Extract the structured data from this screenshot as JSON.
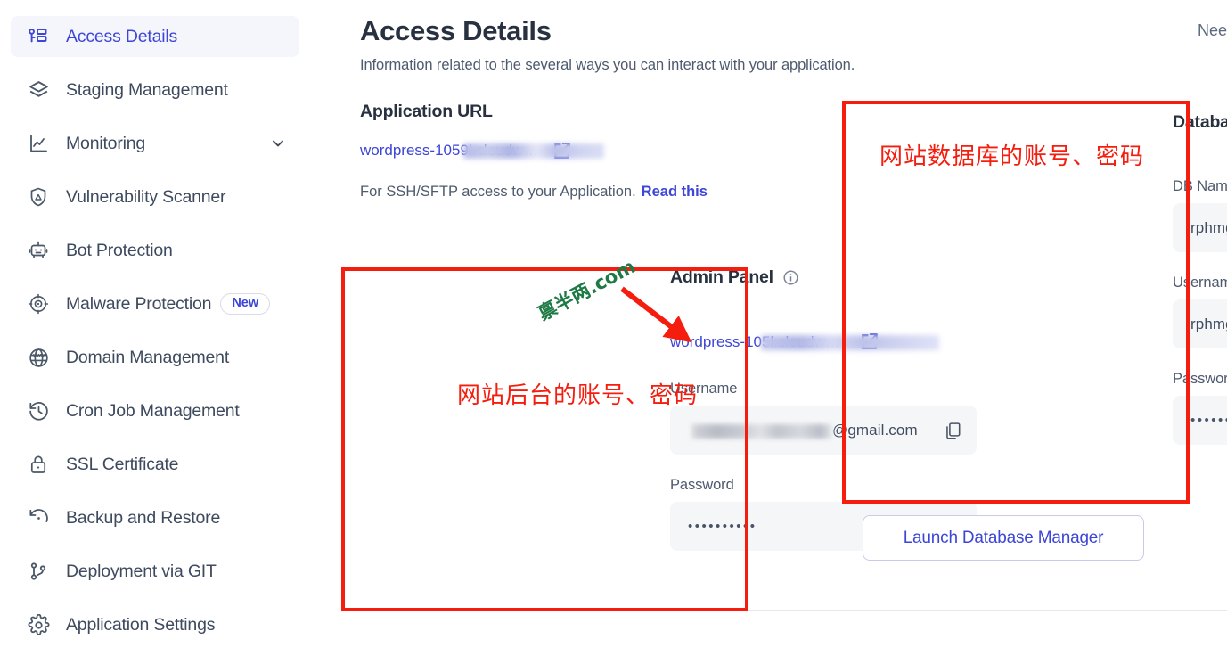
{
  "sidebar": {
    "items": [
      {
        "label": "Access Details",
        "icon": "key-list-icon",
        "active": true
      },
      {
        "label": "Staging Management",
        "icon": "layers-icon",
        "active": false
      },
      {
        "label": "Monitoring",
        "icon": "chart-line-icon",
        "active": false,
        "chevron": "chevron-down-icon"
      },
      {
        "label": "Vulnerability Scanner",
        "icon": "shield-warning-icon",
        "active": false
      },
      {
        "label": "Bot Protection",
        "icon": "robot-icon",
        "active": false
      },
      {
        "label": "Malware Protection",
        "icon": "malware-target-icon",
        "active": false,
        "badge": "New"
      },
      {
        "label": "Domain Management",
        "icon": "www-globe-icon",
        "active": false
      },
      {
        "label": "Cron Job Management",
        "icon": "clock-history-icon",
        "active": false
      },
      {
        "label": "SSL Certificate",
        "icon": "lock-icon",
        "active": false
      },
      {
        "label": "Backup and Restore",
        "icon": "restore-icon",
        "active": false
      },
      {
        "label": "Deployment via GIT",
        "icon": "git-branch-icon",
        "active": false
      },
      {
        "label": "Application Settings",
        "icon": "gear-icon",
        "active": false
      }
    ]
  },
  "header": {
    "title": "Access Details",
    "subtitle": "Information related to the several ways you can interact with your application.",
    "need_help": "Nee"
  },
  "application_url": {
    "section_title": "Application URL",
    "url_prefix": "wordpress-1059",
    "url_suffix": "l.cloudw…",
    "external_link_icon": "external-link-icon",
    "ssh_note": "For SSH/SFTP access to your Application.",
    "ssh_link": "Read this"
  },
  "admin_panel": {
    "title": "Admin Panel",
    "info_icon": "info-circle-icon",
    "url_prefix": "wordpress-105",
    "url_suffix": "l.cloudw…",
    "external_link_icon": "external-link-icon",
    "username_label": "Username",
    "username_value": "@gmail.com",
    "password_label": "Password",
    "password_value": "••••••••••",
    "copy_icon": "copy-icon",
    "edit_icon": "pencil-icon"
  },
  "database": {
    "title": "Database",
    "db_name_label": "DB Name",
    "db_name_value": "rphmggpkvd",
    "username_label": "Username",
    "username_value": "rphmggpkvd",
    "password_label": "Password",
    "password_value": "••••••••••",
    "copy_icon": "copy-icon",
    "edit_icon": "pencil-icon",
    "launch_button": "Launch Database Manager"
  },
  "annotations": {
    "admin_note": "网站后台的账号、密码",
    "db_note": "网站数据库的账号、密码",
    "watermark": "禀半两.com",
    "box_color": "#f51d0e",
    "arrow_color": "#f51d0e",
    "watermark_color": "#1d7a44"
  },
  "colors": {
    "accent": "#3d46d6",
    "text_dark": "#28313f",
    "text_muted": "#4e5a6e",
    "field_bg": "#f5f6f8",
    "active_bg": "#f4f6fb"
  }
}
